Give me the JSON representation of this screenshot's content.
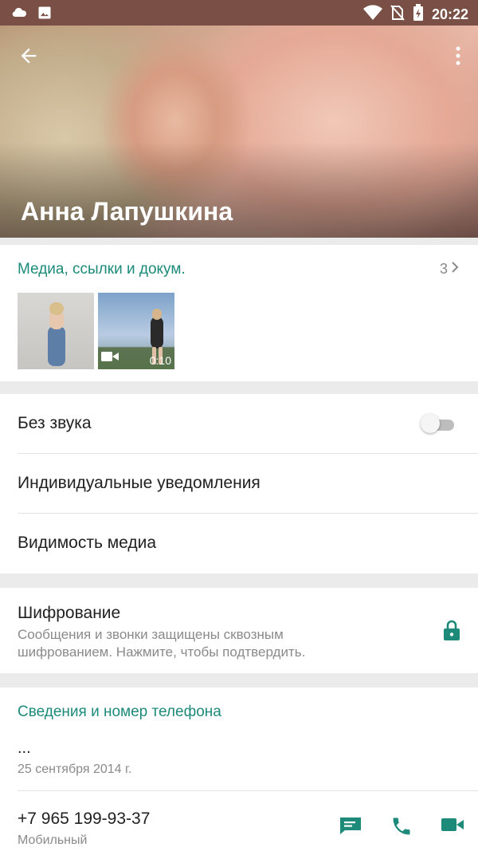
{
  "status_bar": {
    "time": "20:22",
    "left_icons": [
      "cloud-icon",
      "image-icon"
    ],
    "right_icons": [
      "wifi-icon",
      "no-sim-icon",
      "battery-charging-icon"
    ]
  },
  "header": {
    "contact_name": "Анна Лапушкина",
    "back_icon": "arrow-back-icon",
    "menu_icon": "more-vert-icon"
  },
  "media": {
    "title": "Медиа, ссылки и докум.",
    "count": "3",
    "video_duration": "0:10"
  },
  "settings": {
    "mute_label": "Без звука",
    "mute_on": false,
    "custom_notifications_label": "Индивидуальные уведомления",
    "media_visibility_label": "Видимость медиа"
  },
  "encryption": {
    "title": "Шифрование",
    "description": "Сообщения и звонки защищены сквозным шифрованием. Нажмите, чтобы подтвердить."
  },
  "info": {
    "section_title": "Сведения и номер телефона",
    "about": "...",
    "about_date": "25 сентября 2014 г.",
    "phone": "+7 965 199-93-37",
    "phone_type": "Мобильный"
  },
  "colors": {
    "accent": "#1d8a7a",
    "status_bar": "#7a5046"
  }
}
